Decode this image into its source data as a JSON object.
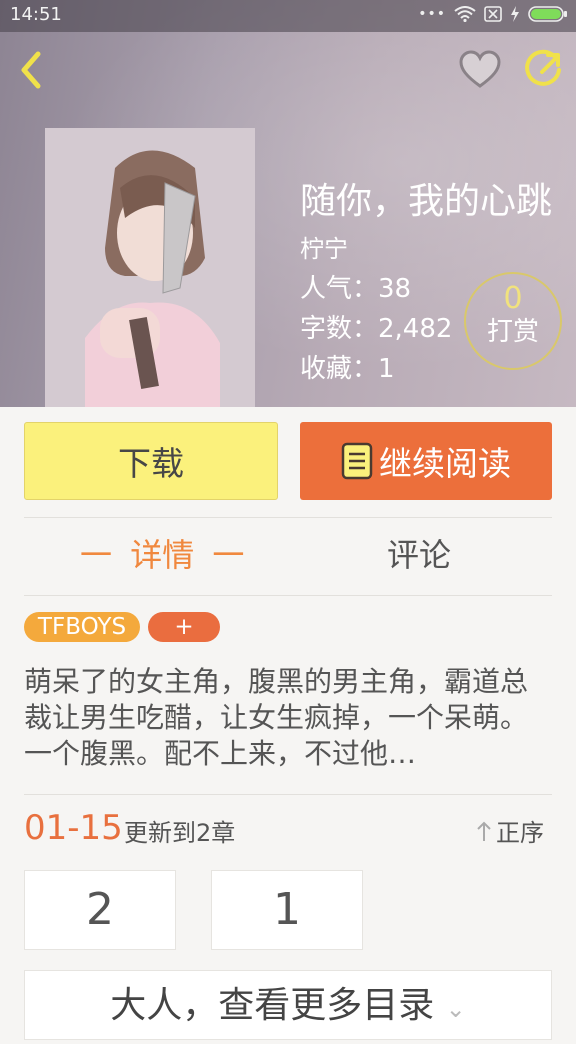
{
  "status_bar": {
    "time": "14:51",
    "icons": [
      "more-dots-icon",
      "wifi-icon",
      "sim-x-icon",
      "charging-icon",
      "battery-icon"
    ]
  },
  "header": {
    "back_icon": "back-arrow-icon",
    "favorite_icon": "heart-icon",
    "share_icon": "share-icon"
  },
  "book": {
    "title": "随你，我的心跳",
    "author": "柠宁",
    "popularity": "人气：38",
    "word_count": "字数：2,482",
    "favorites": "收藏：1",
    "reward_count": "0",
    "reward_label": "打赏"
  },
  "actions": {
    "download_label": "下载",
    "read_label": "继续阅读"
  },
  "tabs": {
    "details": "详情",
    "comments": "评论"
  },
  "tags": {
    "tag1": "TFBOYS",
    "add": "+"
  },
  "description": "萌呆了的女主角，腹黑的男主角，霸道总裁让男生吃醋，让女生疯掉，一个呆萌。一个腹黑。配不上来，不过他…",
  "update": {
    "date": "01-15",
    "text": "更新到2章",
    "sort_label": "正序"
  },
  "chapters": [
    "2",
    "1"
  ],
  "more_catalog": "大人，查看更多目录",
  "colors": {
    "accent_orange": "#ec6f3b",
    "yellow": "#fbf17c",
    "tab_active": "#f0883e"
  }
}
